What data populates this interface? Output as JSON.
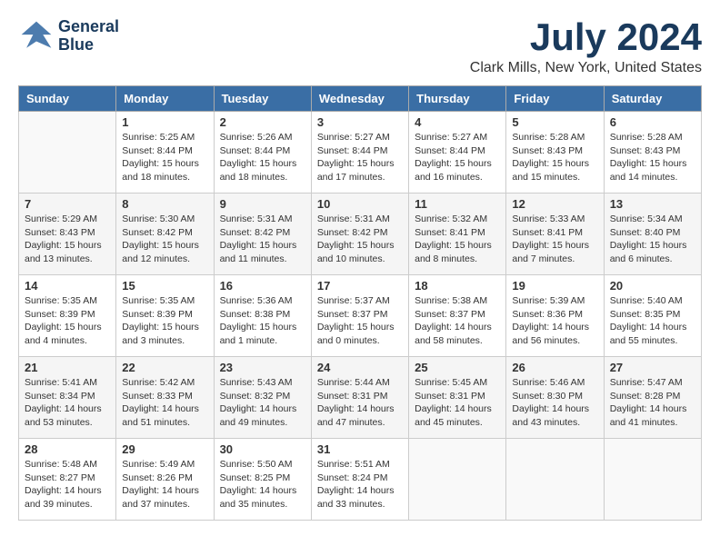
{
  "header": {
    "logo_line1": "General",
    "logo_line2": "Blue",
    "month_title": "July 2024",
    "location": "Clark Mills, New York, United States"
  },
  "days_of_week": [
    "Sunday",
    "Monday",
    "Tuesday",
    "Wednesday",
    "Thursday",
    "Friday",
    "Saturday"
  ],
  "weeks": [
    [
      {
        "day": "",
        "info": ""
      },
      {
        "day": "1",
        "info": "Sunrise: 5:25 AM\nSunset: 8:44 PM\nDaylight: 15 hours\nand 18 minutes."
      },
      {
        "day": "2",
        "info": "Sunrise: 5:26 AM\nSunset: 8:44 PM\nDaylight: 15 hours\nand 18 minutes."
      },
      {
        "day": "3",
        "info": "Sunrise: 5:27 AM\nSunset: 8:44 PM\nDaylight: 15 hours\nand 17 minutes."
      },
      {
        "day": "4",
        "info": "Sunrise: 5:27 AM\nSunset: 8:44 PM\nDaylight: 15 hours\nand 16 minutes."
      },
      {
        "day": "5",
        "info": "Sunrise: 5:28 AM\nSunset: 8:43 PM\nDaylight: 15 hours\nand 15 minutes."
      },
      {
        "day": "6",
        "info": "Sunrise: 5:28 AM\nSunset: 8:43 PM\nDaylight: 15 hours\nand 14 minutes."
      }
    ],
    [
      {
        "day": "7",
        "info": "Sunrise: 5:29 AM\nSunset: 8:43 PM\nDaylight: 15 hours\nand 13 minutes."
      },
      {
        "day": "8",
        "info": "Sunrise: 5:30 AM\nSunset: 8:42 PM\nDaylight: 15 hours\nand 12 minutes."
      },
      {
        "day": "9",
        "info": "Sunrise: 5:31 AM\nSunset: 8:42 PM\nDaylight: 15 hours\nand 11 minutes."
      },
      {
        "day": "10",
        "info": "Sunrise: 5:31 AM\nSunset: 8:42 PM\nDaylight: 15 hours\nand 10 minutes."
      },
      {
        "day": "11",
        "info": "Sunrise: 5:32 AM\nSunset: 8:41 PM\nDaylight: 15 hours\nand 8 minutes."
      },
      {
        "day": "12",
        "info": "Sunrise: 5:33 AM\nSunset: 8:41 PM\nDaylight: 15 hours\nand 7 minutes."
      },
      {
        "day": "13",
        "info": "Sunrise: 5:34 AM\nSunset: 8:40 PM\nDaylight: 15 hours\nand 6 minutes."
      }
    ],
    [
      {
        "day": "14",
        "info": "Sunrise: 5:35 AM\nSunset: 8:39 PM\nDaylight: 15 hours\nand 4 minutes."
      },
      {
        "day": "15",
        "info": "Sunrise: 5:35 AM\nSunset: 8:39 PM\nDaylight: 15 hours\nand 3 minutes."
      },
      {
        "day": "16",
        "info": "Sunrise: 5:36 AM\nSunset: 8:38 PM\nDaylight: 15 hours\nand 1 minute."
      },
      {
        "day": "17",
        "info": "Sunrise: 5:37 AM\nSunset: 8:37 PM\nDaylight: 15 hours\nand 0 minutes."
      },
      {
        "day": "18",
        "info": "Sunrise: 5:38 AM\nSunset: 8:37 PM\nDaylight: 14 hours\nand 58 minutes."
      },
      {
        "day": "19",
        "info": "Sunrise: 5:39 AM\nSunset: 8:36 PM\nDaylight: 14 hours\nand 56 minutes."
      },
      {
        "day": "20",
        "info": "Sunrise: 5:40 AM\nSunset: 8:35 PM\nDaylight: 14 hours\nand 55 minutes."
      }
    ],
    [
      {
        "day": "21",
        "info": "Sunrise: 5:41 AM\nSunset: 8:34 PM\nDaylight: 14 hours\nand 53 minutes."
      },
      {
        "day": "22",
        "info": "Sunrise: 5:42 AM\nSunset: 8:33 PM\nDaylight: 14 hours\nand 51 minutes."
      },
      {
        "day": "23",
        "info": "Sunrise: 5:43 AM\nSunset: 8:32 PM\nDaylight: 14 hours\nand 49 minutes."
      },
      {
        "day": "24",
        "info": "Sunrise: 5:44 AM\nSunset: 8:31 PM\nDaylight: 14 hours\nand 47 minutes."
      },
      {
        "day": "25",
        "info": "Sunrise: 5:45 AM\nSunset: 8:31 PM\nDaylight: 14 hours\nand 45 minutes."
      },
      {
        "day": "26",
        "info": "Sunrise: 5:46 AM\nSunset: 8:30 PM\nDaylight: 14 hours\nand 43 minutes."
      },
      {
        "day": "27",
        "info": "Sunrise: 5:47 AM\nSunset: 8:28 PM\nDaylight: 14 hours\nand 41 minutes."
      }
    ],
    [
      {
        "day": "28",
        "info": "Sunrise: 5:48 AM\nSunset: 8:27 PM\nDaylight: 14 hours\nand 39 minutes."
      },
      {
        "day": "29",
        "info": "Sunrise: 5:49 AM\nSunset: 8:26 PM\nDaylight: 14 hours\nand 37 minutes."
      },
      {
        "day": "30",
        "info": "Sunrise: 5:50 AM\nSunset: 8:25 PM\nDaylight: 14 hours\nand 35 minutes."
      },
      {
        "day": "31",
        "info": "Sunrise: 5:51 AM\nSunset: 8:24 PM\nDaylight: 14 hours\nand 33 minutes."
      },
      {
        "day": "",
        "info": ""
      },
      {
        "day": "",
        "info": ""
      },
      {
        "day": "",
        "info": ""
      }
    ]
  ]
}
